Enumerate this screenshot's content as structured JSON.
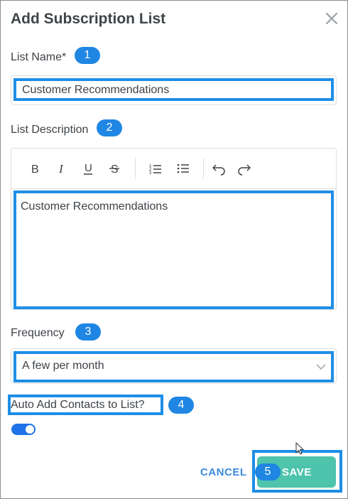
{
  "dialog": {
    "title": "Add Subscription List"
  },
  "list_name": {
    "label": "List Name*",
    "badge": "1",
    "value": "Customer Recommendations"
  },
  "list_description": {
    "label": "List Description",
    "badge": "2",
    "value": "Customer Recommendations",
    "toolbar": [
      "bold-icon",
      "italic-icon",
      "underline-icon",
      "strikethrough-icon",
      "numbered-list-icon",
      "bullet-list-icon",
      "undo-icon",
      "redo-icon"
    ]
  },
  "frequency": {
    "label": "Frequency",
    "badge": "3",
    "selected": "A few per month"
  },
  "auto_add": {
    "label": "Auto Add Contacts to List?",
    "badge": "4",
    "enabled": true
  },
  "actions": {
    "cancel_label": "CANCEL",
    "save_badge": "5",
    "save_label": "SAVE"
  },
  "colors": {
    "accent": "#1f86e3",
    "highlight": "#1e8ee6",
    "save": "#4ec4ad",
    "toggle": "#1f73e8"
  }
}
